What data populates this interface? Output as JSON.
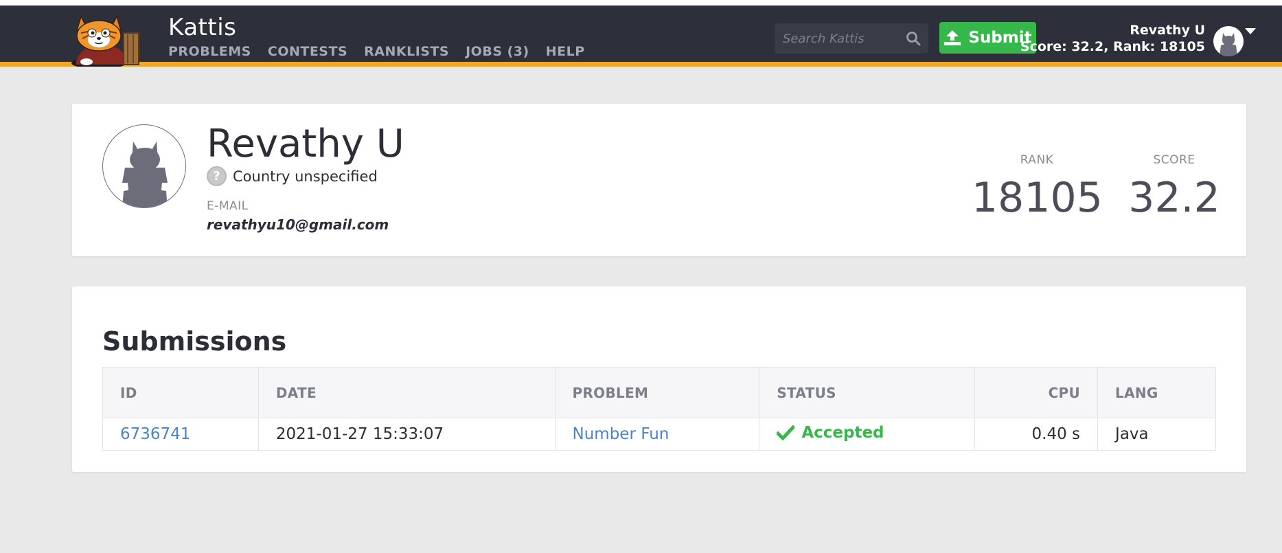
{
  "brand": "Kattis",
  "nav": {
    "items": [
      {
        "label": "PROBLEMS"
      },
      {
        "label": "CONTESTS"
      },
      {
        "label": "RANKLISTS"
      },
      {
        "label": "JOBS (3)"
      },
      {
        "label": "HELP"
      }
    ]
  },
  "search": {
    "placeholder": "Search Kattis",
    "icon": "search-icon"
  },
  "submit_label": "Submit",
  "user": {
    "name": "Revathy U",
    "score_line": "Score: 32.2, Rank: 18105"
  },
  "profile": {
    "name": "Revathy U",
    "country": "Country unspecified",
    "email_label": "E-MAIL",
    "email": "revathyu10@gmail.com",
    "rank_label": "RANK",
    "rank": "18105",
    "score_label": "SCORE",
    "score": "32.2"
  },
  "submissions": {
    "title": "Submissions",
    "columns": {
      "id": "ID",
      "date": "DATE",
      "problem": "PROBLEM",
      "status": "STATUS",
      "cpu": "CPU",
      "lang": "LANG"
    },
    "rows": [
      {
        "id": "6736741",
        "date": "2021-01-27 15:33:07",
        "problem": "Number Fun",
        "status": "Accepted",
        "cpu": "0.40 s",
        "lang": "Java"
      }
    ]
  },
  "colors": {
    "navbar": "#2d2f3a",
    "accent_stripe": "#f1a826",
    "submit_green": "#36b74a",
    "link_blue": "#4a84c4"
  }
}
